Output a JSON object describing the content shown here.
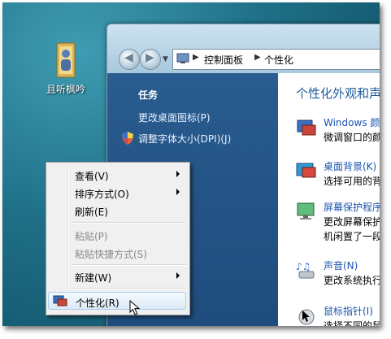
{
  "desktop": {
    "icon_label": "且听枫吟"
  },
  "window": {
    "address": [
      "控制面板",
      "个性化"
    ]
  },
  "left_pane": {
    "title": "任务",
    "links": [
      "更改桌面图标(P)",
      "调整字体大小(DPI)(J)"
    ]
  },
  "right_pane": {
    "heading": "个性化外观和声",
    "items": [
      {
        "title": "Windows 颜色",
        "desc": "微调窗口的颜"
      },
      {
        "title": "桌面背景(K)",
        "desc": "选择可用的背"
      },
      {
        "title": "屏幕保护程序",
        "desc": "更改屏幕保护",
        "desc2": "机闲置了一段"
      },
      {
        "title": "声音(N)",
        "desc": "更改系统执行"
      },
      {
        "title": "鼠标指针(I)",
        "desc": "选择不同的鼠"
      }
    ]
  },
  "context_menu": {
    "items": [
      {
        "label": "查看(V)",
        "submenu": true,
        "disabled": false
      },
      {
        "label": "排序方式(O)",
        "submenu": true,
        "disabled": false
      },
      {
        "label": "刷新(E)",
        "submenu": false,
        "disabled": false
      },
      {
        "label": "粘贴(P)",
        "submenu": false,
        "disabled": true
      },
      {
        "label": "粘贴快捷方式(S)",
        "submenu": false,
        "disabled": true
      },
      {
        "label": "新建(W)",
        "submenu": true,
        "disabled": false
      },
      {
        "label": "个性化(R)",
        "submenu": false,
        "disabled": false,
        "highlighted": true
      }
    ]
  },
  "colors": {
    "left_pane_bg": "#1d4b7c",
    "link_blue": "#1a55b0",
    "heading_blue": "#1e5a9c",
    "menu_highlight": "#dceaf7"
  }
}
